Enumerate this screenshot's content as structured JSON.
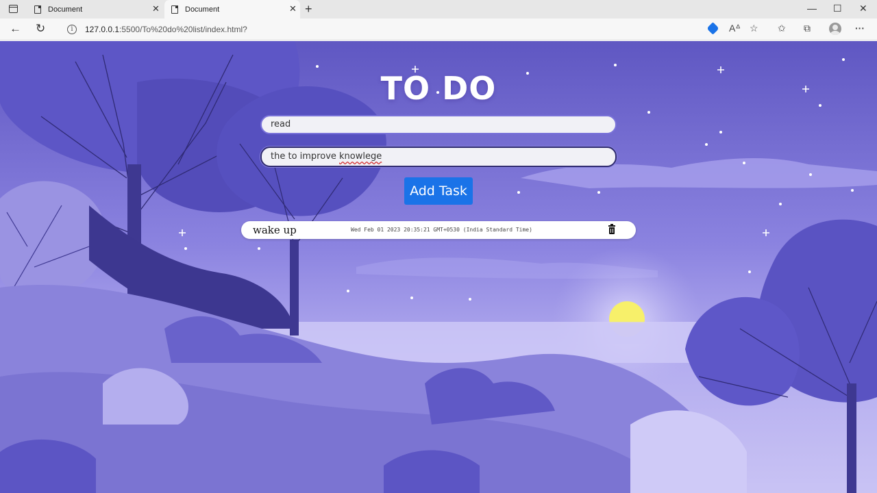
{
  "browser": {
    "tabs": [
      {
        "title": "Document"
      },
      {
        "title": "Document"
      }
    ],
    "new_tab_symbol": "+",
    "address_host": "127.0.0.1",
    "address_path": ":5500/To%20do%20list/index.html?",
    "window_controls": {
      "minimize": "—",
      "maximize": "☐",
      "close": "✕"
    }
  },
  "app": {
    "title": "TO DO",
    "title_input_value": "read",
    "desc_input_prefix": "the to improve ",
    "desc_input_misspelled": "knowlege",
    "add_button_label": "Add Task"
  },
  "tasks": [
    {
      "title": "wake up",
      "date": "Wed Feb 01 2023 20:35:21 GMT+0530 (India Standard Time)"
    }
  ],
  "icons": [
    "sidebar-toggle-icon",
    "document-icon",
    "close-icon",
    "back-arrow-icon",
    "refresh-icon",
    "info-icon",
    "tag-icon",
    "read-aloud-icon",
    "add-favorite-icon",
    "favorites-icon",
    "collections-icon",
    "profile-icon",
    "more-icon",
    "trash-icon"
  ],
  "colors": {
    "sky": "#6a63c9",
    "button": "#1a73e8",
    "sun": "#f7f06a"
  }
}
